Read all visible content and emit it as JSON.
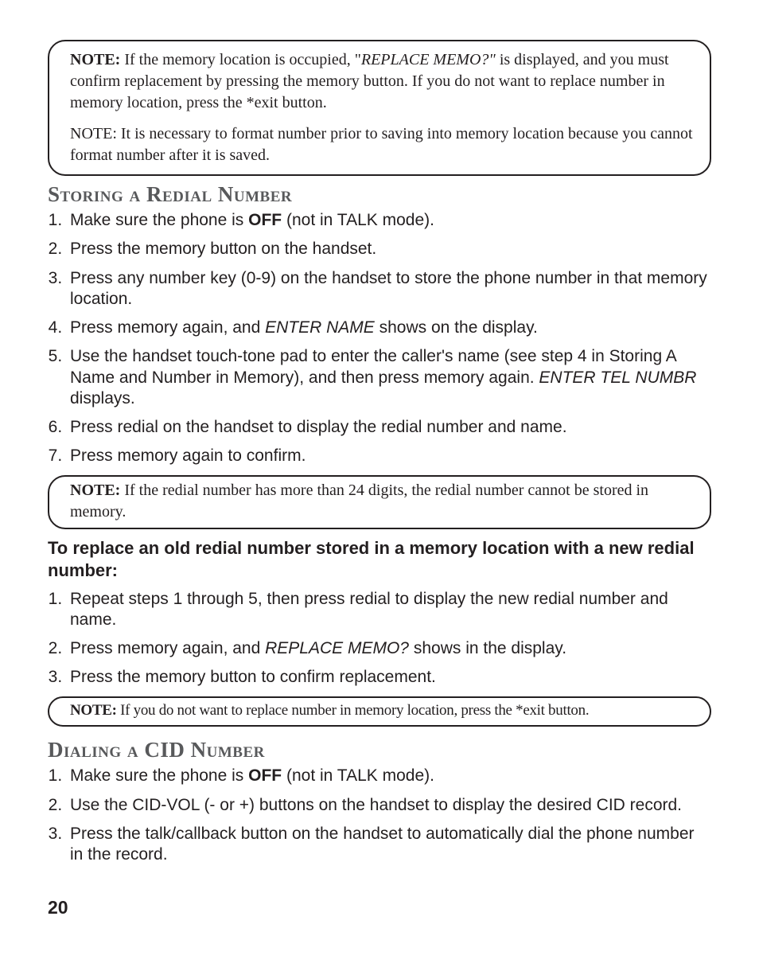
{
  "notes": {
    "top": {
      "p1_prefix": "NOTE:",
      "p1_a": " If the memory location is occupied, \"",
      "p1_b": "REPLACE MEMO?\"",
      "p1_c": " is displayed, and you must confirm replacement by pressing the memory button. If you do not want to replace number in memory location, press the *exit button.",
      "p2": "NOTE: It is necessary to format number prior to saving into memory location because you cannot format number after it is saved."
    },
    "mid": {
      "prefix": "NOTE:",
      "text": " If the redial number has more than 24 digits, the redial number cannot be stored in memory."
    },
    "bottom": {
      "prefix": "NOTE:",
      "text": " If you do not want to replace number in memory location, press the *exit button."
    }
  },
  "section1": {
    "title": "Storing a Redial Number",
    "items": {
      "i1a": "Make sure the phone is ",
      "i1b": "OFF",
      "i1c": " (not in TALK mode).",
      "i2": "Press the memory button on the handset.",
      "i3": "Press any number key (0-9) on the handset to store the phone number in that memory location.",
      "i4a": "Press memory again, and ",
      "i4b": "ENTER NAME",
      "i4c": " shows on the display.",
      "i5a": "Use the handset touch-tone pad to enter the caller's name (see step 4 in Storing A Name and Number in Memory), and then press memory again. ",
      "i5b": "ENTER TEL NUMBR",
      "i5c": " displays.",
      "i6": "Press redial on the handset to display the redial number and name.",
      "i7": "Press memory again to confirm."
    }
  },
  "subhead": "To replace an old redial number stored in a memory location with a new redial number:",
  "replaceList": {
    "i1": "Repeat steps 1 through 5, then press redial to display the new redial number and name.",
    "i2a": "Press memory again, and ",
    "i2b": "REPLACE MEMO?",
    "i2c": " shows in the display.",
    "i3": "Press the memory button to confirm replacement."
  },
  "section2": {
    "title": "Dialing a CID Number",
    "items": {
      "i1a": "Make sure the phone is ",
      "i1b": "OFF",
      "i1c": " (not in TALK mode).",
      "i2": "Use the CID-VOL (- or +) buttons on the handset to display the desired CID record.",
      "i3": "Press the talk/callback button on the handset to automatically dial the phone number in the record."
    }
  },
  "pagenum": "20"
}
